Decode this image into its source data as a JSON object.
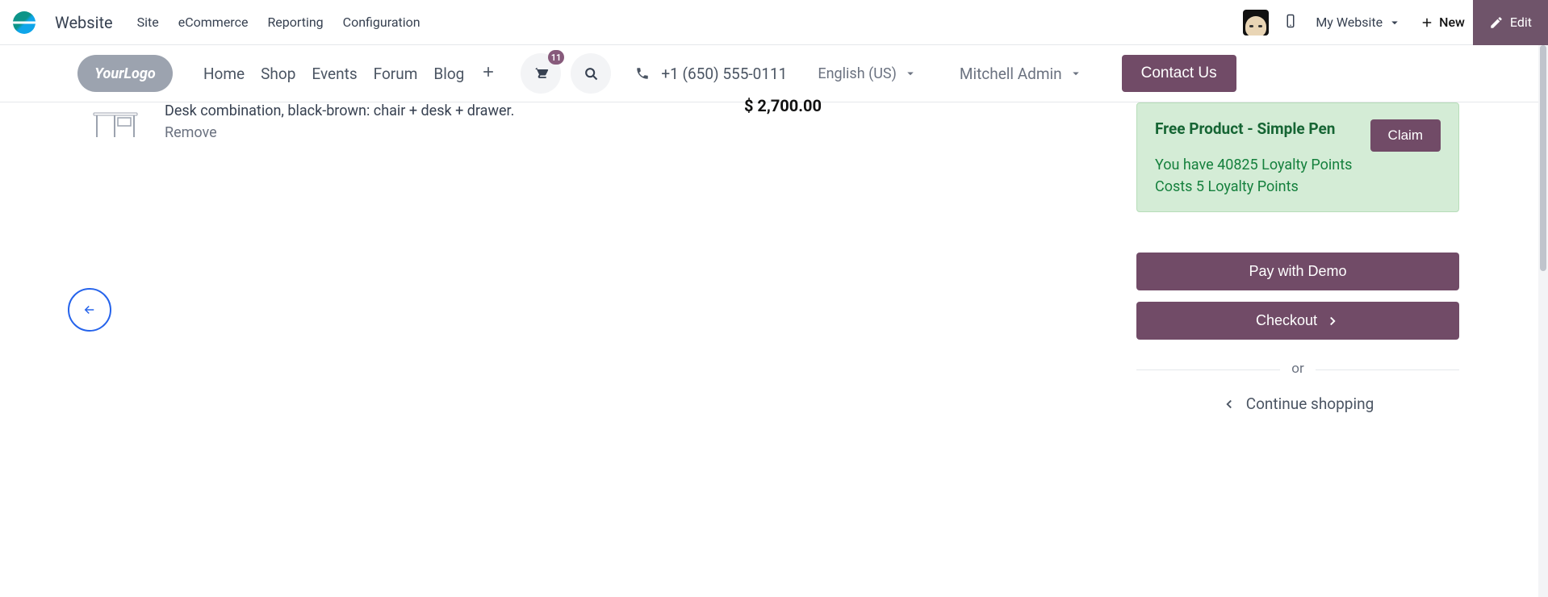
{
  "admin": {
    "app": "Website",
    "menu": [
      "Site",
      "eCommerce",
      "Reporting",
      "Configuration"
    ],
    "mysite": "My Website",
    "new": "New",
    "edit": "Edit"
  },
  "site_header": {
    "logo_text": "YourLogo",
    "nav": [
      "Home",
      "Shop",
      "Events",
      "Forum",
      "Blog"
    ],
    "cart_count": "11",
    "phone": "+1 (650) 555-0111",
    "language": "English (US)",
    "user": "Mitchell Admin",
    "contact": "Contact Us"
  },
  "cart": {
    "line": {
      "desc": "Desk combination, black-brown: chair + desk + drawer.",
      "remove": "Remove",
      "price": "$ 2,700.00"
    }
  },
  "promo": {
    "title": "Free Product - Simple Pen",
    "claim": "Claim",
    "have_points": "You have 40825 Loyalty Points",
    "cost": "Costs 5 Loyalty Points"
  },
  "summary": {
    "pay": "Pay with Demo",
    "checkout": "Checkout",
    "or": "or",
    "continue": "Continue shopping"
  }
}
